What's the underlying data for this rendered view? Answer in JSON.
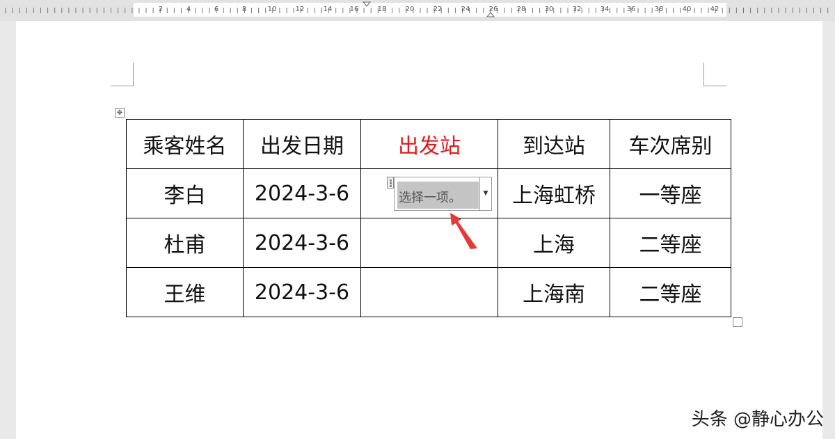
{
  "ruler": {
    "labels": [
      "2",
      "4",
      "6",
      "8",
      "10",
      "12",
      "14",
      "16",
      "18",
      "18",
      "20",
      "22",
      "24",
      "26",
      "28",
      "30",
      "32",
      "34",
      "36",
      "38",
      "40",
      "42"
    ]
  },
  "table": {
    "headers": [
      "乘客姓名",
      "出发日期",
      "出发站",
      "到达站",
      "车次席别"
    ],
    "rows": [
      {
        "name": "李白",
        "date": "2024-3-6",
        "depart": "",
        "arrive": "上海虹桥",
        "seat": "一等座"
      },
      {
        "name": "杜甫",
        "date": "2024-3-6",
        "depart": "",
        "arrive": "上海",
        "seat": "二等座"
      },
      {
        "name": "王维",
        "date": "2024-3-6",
        "depart": "",
        "arrive": "上海南",
        "seat": "二等座"
      }
    ]
  },
  "content_control": {
    "placeholder": "选择一项。",
    "dropdown_icon": "triangle-down"
  },
  "colors": {
    "header_highlight": "#e11b1b",
    "annotation_arrow": "#e53935"
  },
  "watermark": "头条 @静心办公"
}
